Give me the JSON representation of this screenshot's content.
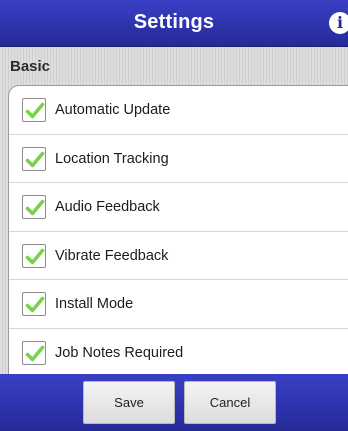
{
  "header": {
    "title": "Settings",
    "info_icon": "i"
  },
  "section": {
    "title": "Basic"
  },
  "settings": [
    {
      "label": "Automatic Update",
      "checked": true
    },
    {
      "label": "Location Tracking",
      "checked": true
    },
    {
      "label": "Audio Feedback",
      "checked": true
    },
    {
      "label": "Vibrate Feedback",
      "checked": true
    },
    {
      "label": "Install Mode",
      "checked": true
    },
    {
      "label": "Job Notes Required",
      "checked": true
    }
  ],
  "footer": {
    "save_label": "Save",
    "cancel_label": "Cancel"
  },
  "colors": {
    "header_blue": "#2e33ad",
    "check_green": "#7ad14a"
  }
}
